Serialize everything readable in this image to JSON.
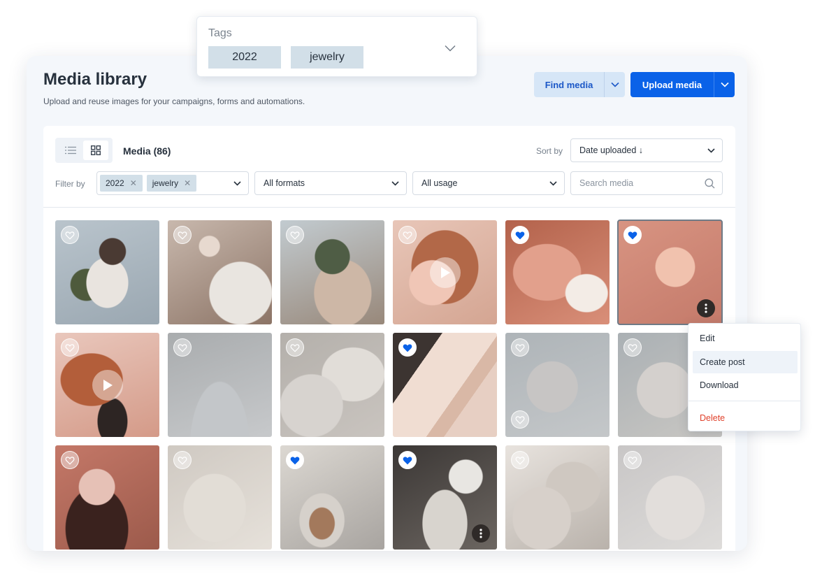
{
  "header": {
    "title": "Media library",
    "subtitle": "Upload and reuse images for your campaigns, forms and automations."
  },
  "actions": {
    "find_media": "Find media",
    "upload_media": "Upload media"
  },
  "colors": {
    "primary": "#0a62e8",
    "secondary_button_bg": "#d6e6f7",
    "favorite_on": "#0a62e8",
    "danger": "#e0412b"
  },
  "tags_popup": {
    "label": "Tags",
    "chips": [
      "2022",
      "jewelry"
    ]
  },
  "toolbar": {
    "media_count": "Media (86)",
    "sort_label": "Sort by",
    "sort_value": "Date uploaded ↓",
    "filter_label": "Filter by",
    "filter_tags": [
      "2022",
      "jewelry"
    ],
    "format_value": "All formats",
    "usage_value": "All usage",
    "search_placeholder": "Search media"
  },
  "media": [
    {
      "favorite": false,
      "video": false
    },
    {
      "favorite": false,
      "video": false
    },
    {
      "favorite": false,
      "video": false
    },
    {
      "favorite": false,
      "video": true
    },
    {
      "favorite": true,
      "video": false
    },
    {
      "favorite": true,
      "video": false,
      "selected": true,
      "menu": true
    },
    {
      "favorite": false,
      "video": true
    },
    {
      "favorite": false,
      "video": false
    },
    {
      "favorite": false,
      "video": false
    },
    {
      "favorite": true,
      "video": false
    },
    {
      "favorite": false,
      "video": false
    },
    {
      "favorite": false,
      "video": false
    },
    {
      "favorite": false,
      "video": false
    },
    {
      "favorite": false,
      "video": false
    },
    {
      "favorite": true,
      "video": false
    },
    {
      "favorite": true,
      "video": false,
      "menu": true
    },
    {
      "favorite": false,
      "video": false
    },
    {
      "favorite": false,
      "video": false
    }
  ],
  "context_menu": {
    "items": [
      "Edit",
      "Create post",
      "Download"
    ],
    "danger_item": "Delete"
  }
}
